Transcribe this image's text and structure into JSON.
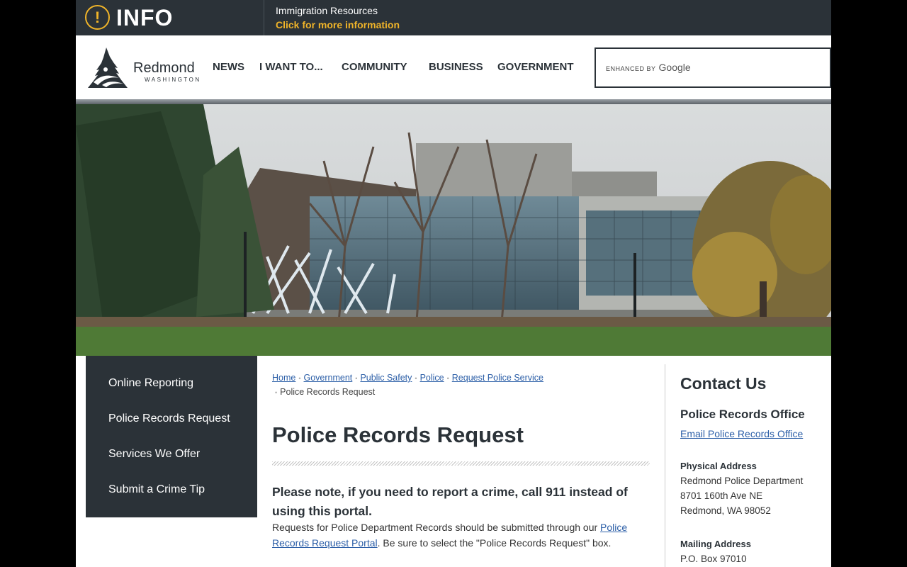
{
  "alert": {
    "title": "INFO",
    "icon": "exclamation-icon",
    "message": "Immigration Resources",
    "link": "Click for more information",
    "accent_color": "#f0b429",
    "background_color": "#2b3238"
  },
  "header": {
    "logo": {
      "name": "Redmond",
      "sub": "WASHINGTON"
    },
    "nav": [
      "NEWS",
      "I WANT TO...",
      "COMMUNITY",
      "BUSINESS",
      "GOVERNMENT"
    ],
    "search": {
      "enhanced_label": "ENHANCED BY",
      "provider": "Google"
    }
  },
  "hero": {
    "description_icon": "city-hall-photo"
  },
  "sidebar": {
    "items": [
      "Online Reporting",
      "Police Records Request",
      "Services We Offer",
      "Submit a Crime Tip"
    ]
  },
  "breadcrumb": {
    "links": [
      "Home",
      "Government",
      "Public Safety",
      "Police",
      "Request Police Service"
    ],
    "current": "Police Records Request"
  },
  "main": {
    "title": "Police Records Request",
    "notice": "Please note, if you need to report a crime, call 911 instead of using this portal.",
    "body_before": "Requests for Police Department Records should be submitted through our ",
    "body_link": "Police Records Request Portal",
    "body_after": ". Be sure to select the \"Police Records Request\" box."
  },
  "contact": {
    "title": "Contact Us",
    "office": "Police Records Office",
    "email_link": "Email Police Records Office",
    "physical_heading": "Physical Address",
    "physical_lines": [
      "Redmond Police Department",
      "8701 160th Ave NE",
      "Redmond, WA 98052"
    ],
    "mailing_heading": "Mailing Address",
    "mailing_lines": [
      "P.O. Box 97010"
    ]
  },
  "colors": {
    "dark": "#2b3238",
    "link": "#2b5ea7",
    "accent": "#f0b429"
  }
}
